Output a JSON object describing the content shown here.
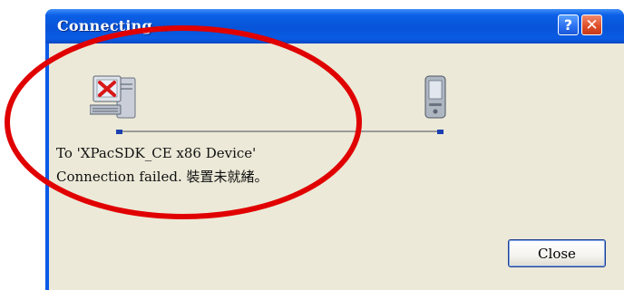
{
  "window": {
    "title": "Connecting...",
    "help_glyph": "?",
    "close_glyph": "✕"
  },
  "status": {
    "line1": "To 'XPacSDK_CE x86 Device'",
    "line2": "Connection failed. 裝置未就緒。"
  },
  "buttons": {
    "close_label": "Close"
  },
  "icons": {
    "source": "computer-error-icon",
    "target": "pda-device-icon"
  },
  "annotation": {
    "shape": "ellipse",
    "color": "#e00000"
  }
}
